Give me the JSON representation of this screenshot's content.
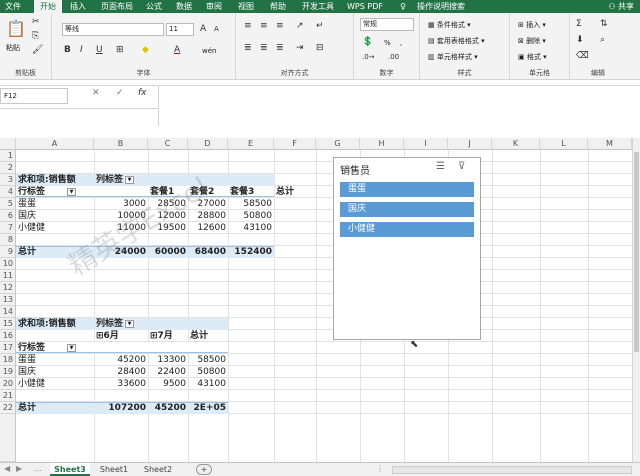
{
  "menu": {
    "tabs": [
      "文件",
      "开始",
      "插入",
      "页面布局",
      "公式",
      "数据",
      "审阅",
      "视图",
      "帮助",
      "开发工具",
      "WPS PDF",
      "操作说明搜索"
    ],
    "active": "开始",
    "share": "共享"
  },
  "ribbon": {
    "clipboard": {
      "paste": "粘贴",
      "label": "剪贴板"
    },
    "font": {
      "name": "等线",
      "size": "11",
      "bold": "B",
      "italic": "I",
      "underline": "U",
      "grow": "A",
      "shrink": "A",
      "color_a": "A",
      "phonetic": "wén",
      "label": "字体"
    },
    "alignment": {
      "label": "对齐方式"
    },
    "number": {
      "format": "常规",
      "percent": "%",
      "comma": ",",
      "label": "数字"
    },
    "styles": {
      "conditional": "条件格式",
      "table": "套用表格格式",
      "cell": "单元格样式",
      "label": "样式"
    },
    "cells": {
      "insert": "插入",
      "delete": "删除",
      "format": "格式",
      "label": "单元格"
    },
    "editing": {
      "sum": "Σ",
      "label": "编辑"
    }
  },
  "formula": {
    "name_box": "F12",
    "fx": "fx",
    "value": ""
  },
  "columns": [
    "A",
    "B",
    "C",
    "D",
    "E",
    "F",
    "G",
    "H",
    "I",
    "J",
    "K",
    "L",
    "M"
  ],
  "rows": [
    "1",
    "2",
    "3",
    "4",
    "5",
    "6",
    "7",
    "8",
    "9",
    "10",
    "11",
    "12",
    "13",
    "14",
    "15",
    "16",
    "17",
    "18",
    "19",
    "20",
    "21",
    "22"
  ],
  "pivot1": {
    "header": "求和项:销售额",
    "col_label": "列标签",
    "row_label": "行标签",
    "cols": [
      "套餐1",
      "套餐2",
      "套餐3",
      "总计"
    ],
    "rows": [
      {
        "name": "蛋蛋",
        "values": [
          "3000",
          "28500",
          "27000",
          "58500"
        ]
      },
      {
        "name": "国庆",
        "values": [
          "10000",
          "12000",
          "28800",
          "50800"
        ]
      },
      {
        "name": "小健健",
        "values": [
          "11000",
          "19500",
          "12600",
          "43100"
        ]
      }
    ],
    "total": {
      "name": "总计",
      "values": [
        "24000",
        "60000",
        "68400",
        "152400"
      ]
    }
  },
  "pivot2": {
    "header": "求和项:销售额",
    "col_label": "列标签",
    "row_label": "行标签",
    "cols": [
      "⊞6月",
      "⊞7月",
      "总计"
    ],
    "rows": [
      {
        "name": "蛋蛋",
        "values": [
          "45200",
          "13300",
          "58500"
        ]
      },
      {
        "name": "国庆",
        "values": [
          "28400",
          "22400",
          "50800"
        ]
      },
      {
        "name": "小健健",
        "values": [
          "33600",
          "9500",
          "43100"
        ]
      }
    ],
    "total": {
      "name": "总计",
      "values": [
        "107200",
        "45200",
        "2E+05"
      ]
    }
  },
  "slicer": {
    "title": "销售员",
    "items": [
      "蛋蛋",
      "国庆",
      "小健健"
    ]
  },
  "sheets": {
    "tabs": [
      "Sheet3",
      "Sheet1",
      "Sheet2"
    ],
    "active": "Sheet3",
    "add": "+"
  },
  "watermark": "精英学Excel"
}
